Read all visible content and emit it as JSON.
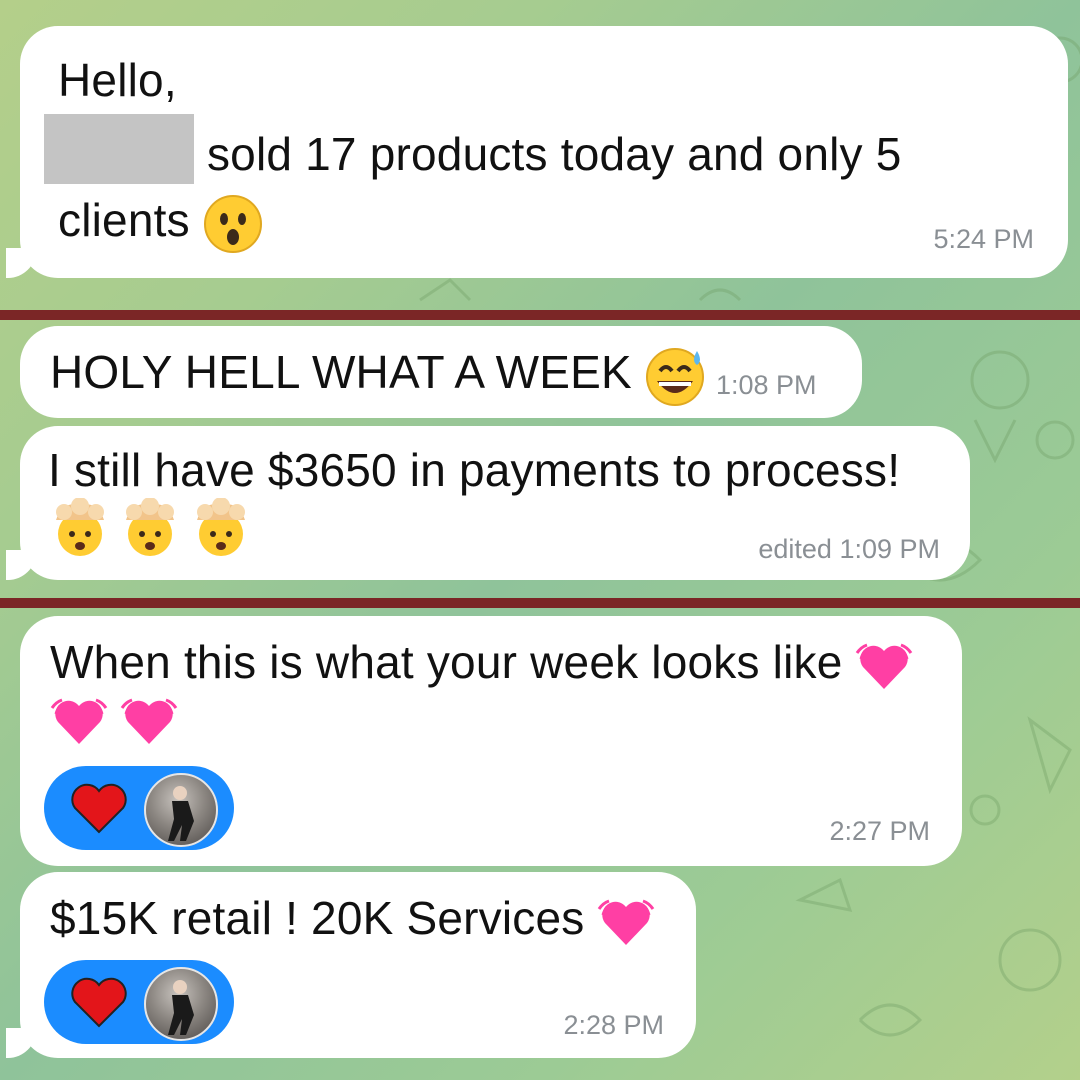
{
  "chat": {
    "messages": [
      {
        "line1": "Hello,",
        "line2": "sold 17 products today and only 5",
        "line3": "clients",
        "emoji": "astonished-face",
        "time": "5:24 PM"
      },
      {
        "text": "HOLY HELL WHAT A WEEK",
        "emoji": "grinning-face-with-sweat",
        "time": "1:08 PM"
      },
      {
        "text": "I still have $3650 in payments to process!",
        "emoji": "exploding-head",
        "time": "edited 1:09 PM"
      },
      {
        "text": "When this is what your week looks like",
        "emoji": "beating-heart",
        "reaction": "red-heart",
        "time": "2:27 PM"
      },
      {
        "text": "$15K retail ! 20K Services",
        "emoji": "beating-heart",
        "reaction": "red-heart",
        "time": "2:28 PM"
      }
    ]
  },
  "colors": {
    "bubble": "#ffffff",
    "divider": "#7b2626",
    "reaction": "#1b8cff",
    "timestamp": "#8a8f94"
  }
}
